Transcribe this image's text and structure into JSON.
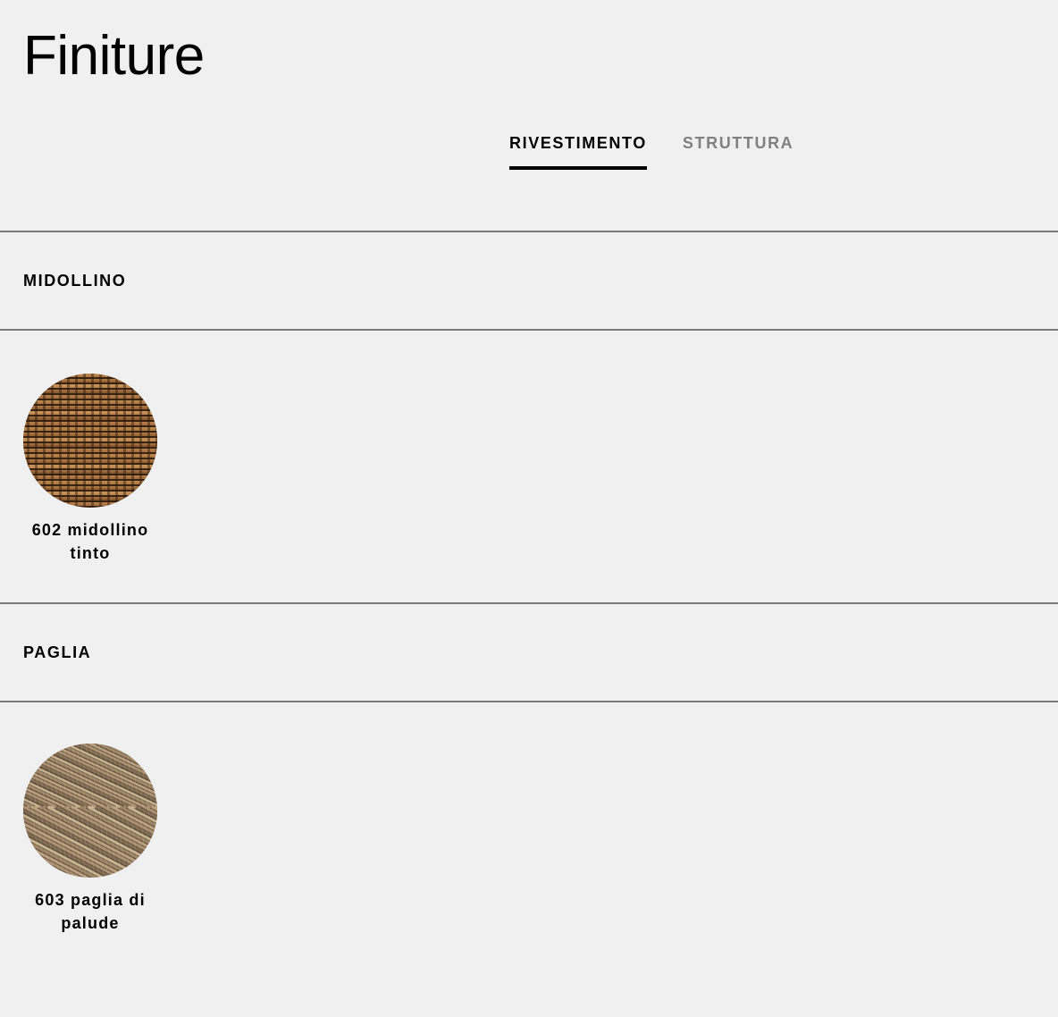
{
  "page": {
    "title": "Finiture"
  },
  "tabs": [
    {
      "label": "RIVESTIMENTO",
      "active": true
    },
    {
      "label": "STRUTTURA",
      "active": false
    }
  ],
  "sections": [
    {
      "title": "MIDOLLINO",
      "swatches": [
        {
          "label": "602 midollino tinto",
          "texture": "woven-rattan",
          "color": "#8a5a32"
        }
      ]
    },
    {
      "title": "PAGLIA",
      "swatches": [
        {
          "label": "603 paglia di palude",
          "texture": "twisted-rush",
          "color": "#a08868"
        }
      ]
    }
  ],
  "colors": {
    "background": "#f0f0f0",
    "divider": "#7a7a7a",
    "active_tab": "#000000",
    "inactive_tab": "#808080"
  }
}
